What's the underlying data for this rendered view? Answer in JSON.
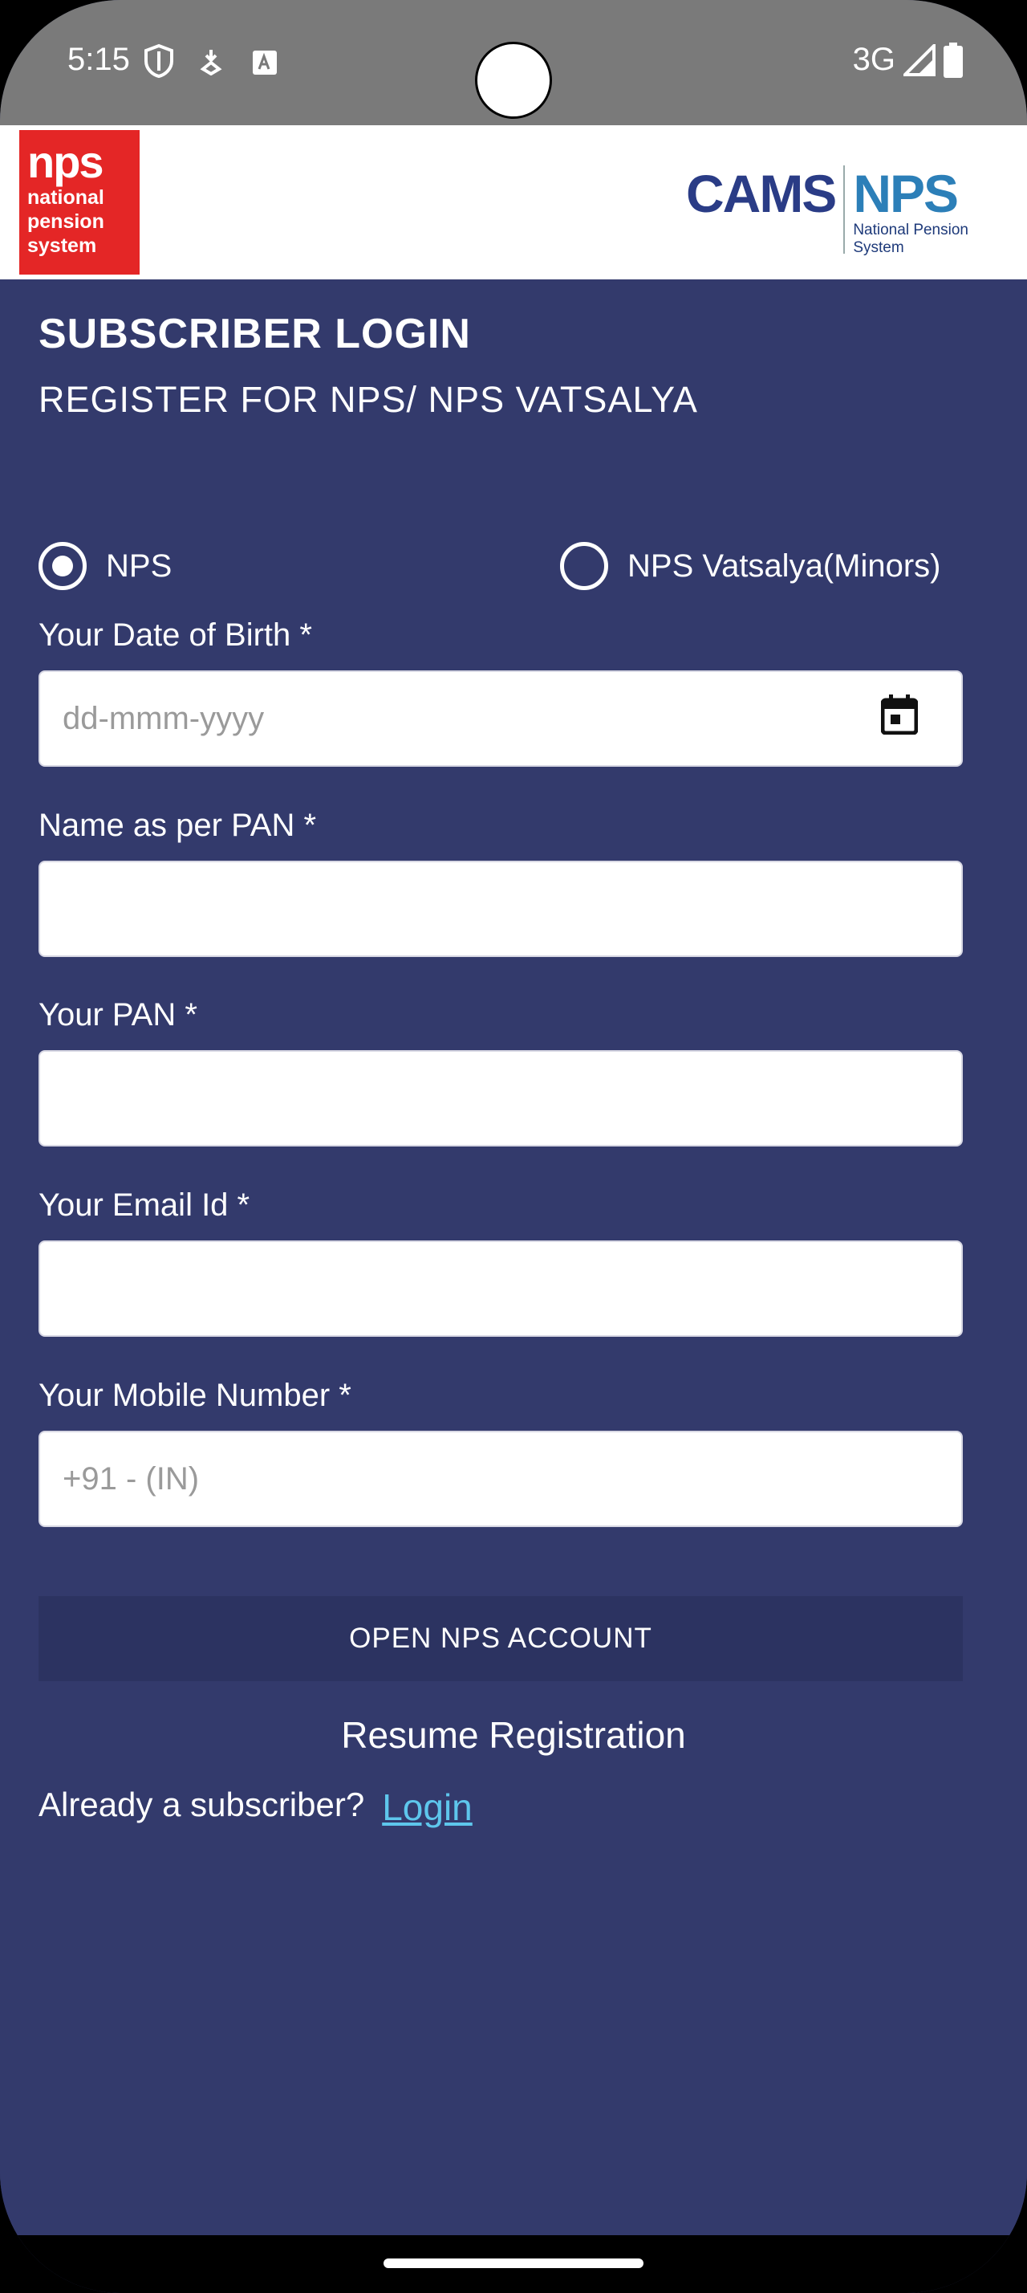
{
  "status_bar": {
    "time": "5:15",
    "network": "3G"
  },
  "header": {
    "nps_logo_main": "nps",
    "nps_logo_lines": [
      "national",
      "pension",
      "system"
    ],
    "cams_text": "CAMS",
    "cams_nps_text": "NPS",
    "cams_nps_subtitle_lines": [
      "National Pension",
      "System"
    ]
  },
  "main": {
    "title": "SUBSCRIBER LOGIN",
    "subtitle": "REGISTER FOR NPS/ NPS VATSALYA",
    "radio_options": [
      {
        "label": "NPS",
        "checked": true
      },
      {
        "label": "NPS Vatsalya(Minors)",
        "checked": false
      }
    ],
    "fields": {
      "dob": {
        "label": "Your Date of Birth *",
        "placeholder": "dd-mmm-yyyy",
        "value": ""
      },
      "name": {
        "label": "Name as per PAN *",
        "placeholder": "",
        "value": ""
      },
      "pan": {
        "label": "Your PAN *",
        "placeholder": "",
        "value": ""
      },
      "email": {
        "label": "Your Email Id *",
        "placeholder": "",
        "value": ""
      },
      "mobile": {
        "label": "Your Mobile Number *",
        "placeholder": "+91 - (IN)",
        "value": ""
      }
    },
    "open_button": "OPEN NPS ACCOUNT",
    "resume_link": "Resume Registration",
    "already_text": "Already a subscriber?",
    "login_link": "Login"
  },
  "colors": {
    "background": "#333a6c",
    "button": "#2c3361",
    "link": "#5ec6ec",
    "nps_red": "#e42626"
  }
}
